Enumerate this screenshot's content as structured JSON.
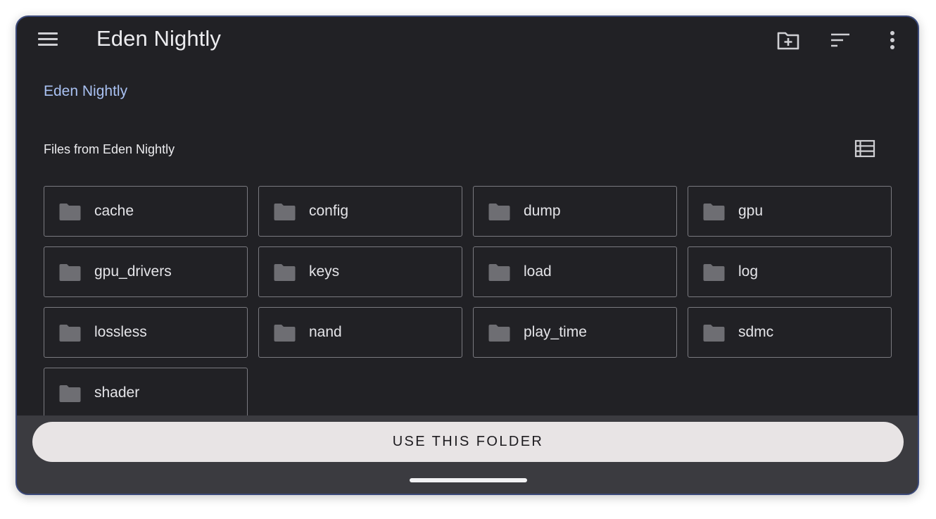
{
  "appbar": {
    "title": "Eden Nightly",
    "menu_icon": "menu-icon",
    "actions": [
      "new-folder-icon",
      "sort-icon",
      "more-vert-icon"
    ]
  },
  "breadcrumb": "Eden Nightly",
  "files_heading": "Files from Eden Nightly",
  "view_toggle_icon": "list-view-icon",
  "folder_icon": "folder-icon",
  "folders": [
    {
      "name": "cache"
    },
    {
      "name": "config"
    },
    {
      "name": "dump"
    },
    {
      "name": "gpu"
    },
    {
      "name": "gpu_drivers"
    },
    {
      "name": "keys"
    },
    {
      "name": "load"
    },
    {
      "name": "log"
    },
    {
      "name": "lossless"
    },
    {
      "name": "nand"
    },
    {
      "name": "play_time"
    },
    {
      "name": "sdmc"
    },
    {
      "name": "shader"
    }
  ],
  "use_folder_label": "USE THIS FOLDER",
  "colors": {
    "background": "#212125",
    "breadcrumb": "#a9c1f2",
    "tile_border": "#7a7a80",
    "folder_icon": "#6e6e73",
    "bottom_bar": "#3b3b40",
    "button": "#e8e4e5"
  }
}
